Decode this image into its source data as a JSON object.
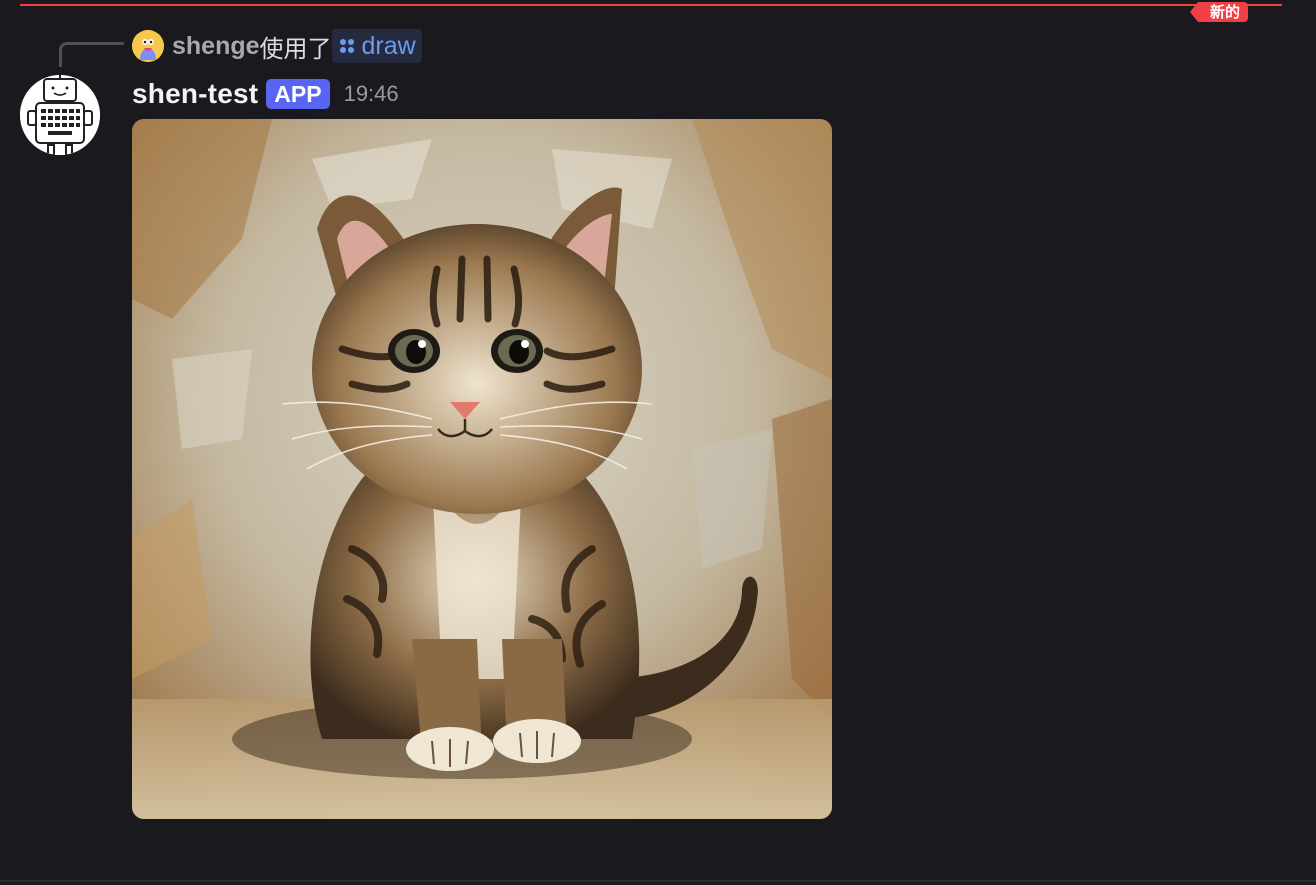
{
  "divider": {
    "label": "新的",
    "color": "#f23f43"
  },
  "reply": {
    "user": "shenge",
    "verb": "使用了",
    "command": "draw",
    "command_icon": "slash-command-icon"
  },
  "message": {
    "username": "shen-test",
    "tag": "APP",
    "timestamp": "19:46",
    "avatar_icon": "robot-typewriter-icon",
    "attachment": {
      "type": "image",
      "description_icon": "kitten-painting-image"
    }
  },
  "colors": {
    "background": "#1a1a1e",
    "accent": "#5865f2",
    "new_marker": "#f23f43",
    "command_text": "#6b9cf0"
  }
}
